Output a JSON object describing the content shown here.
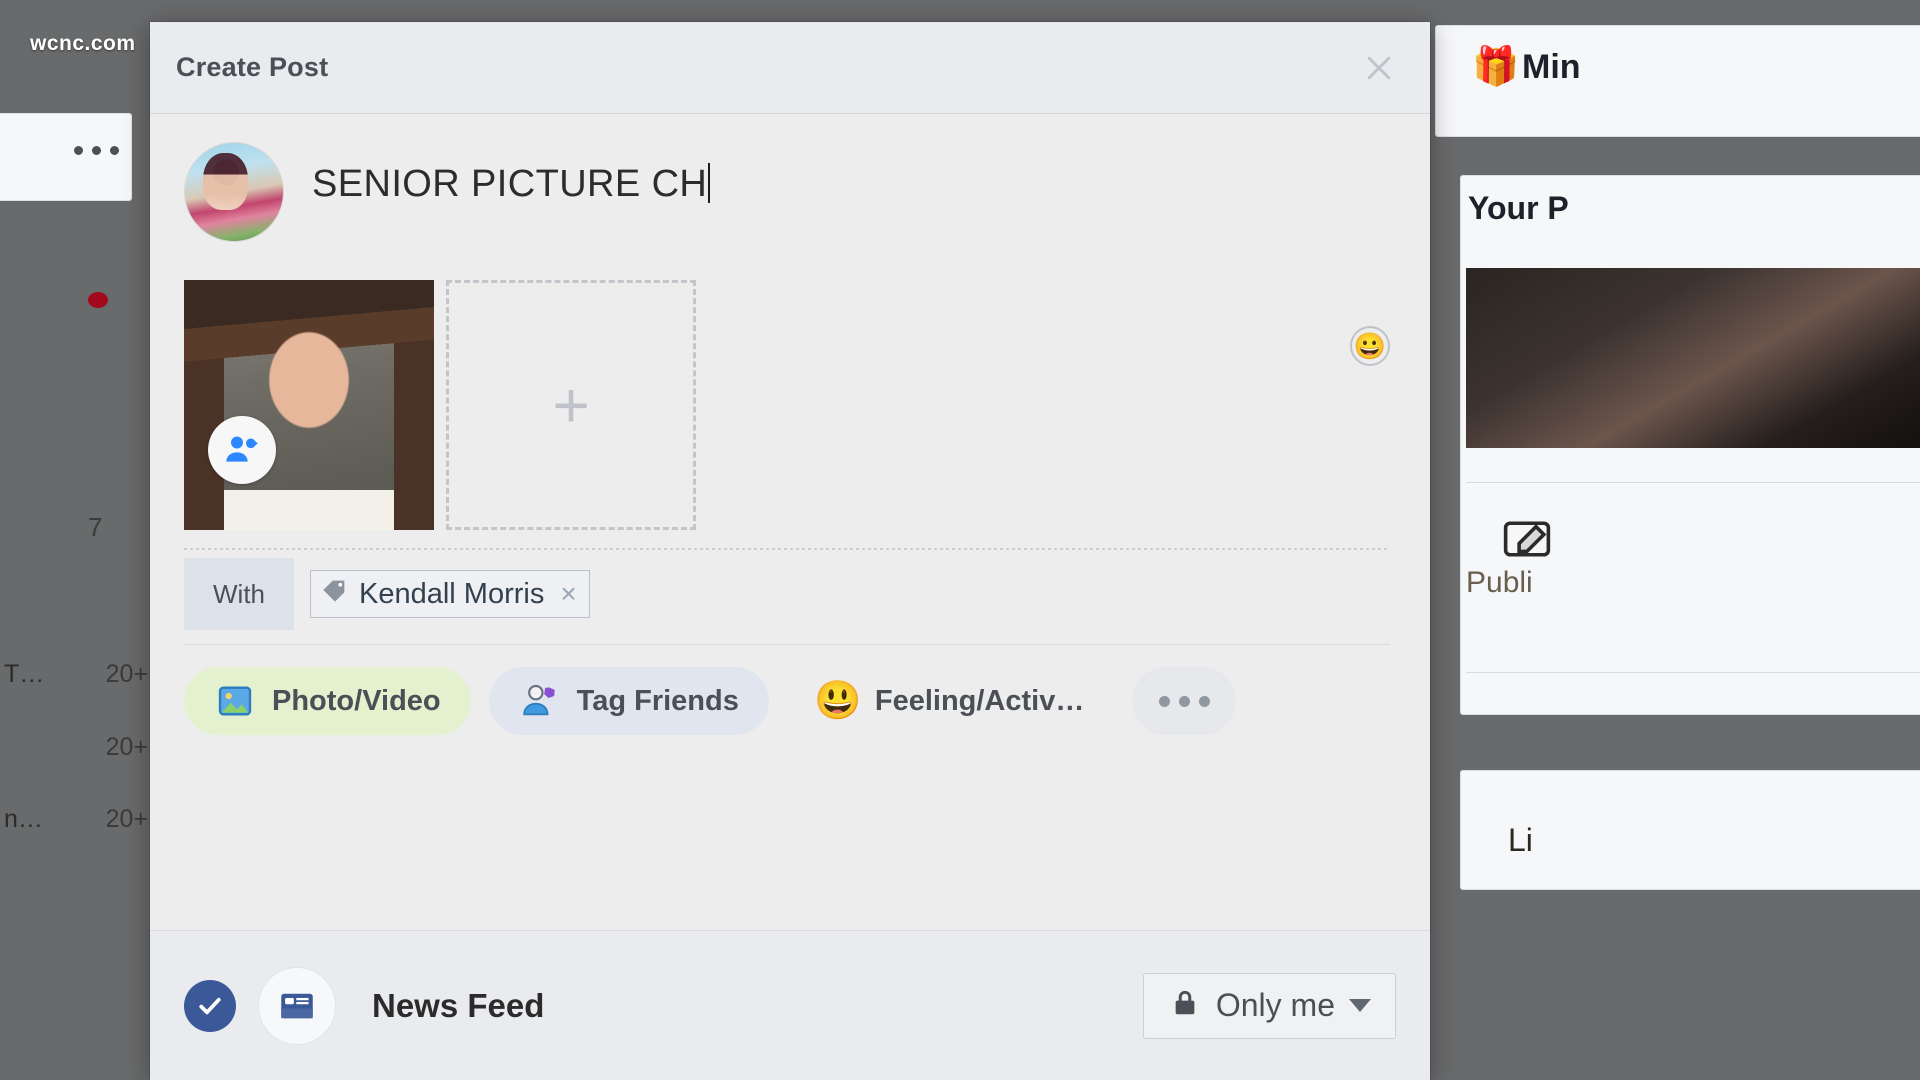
{
  "background": {
    "watermark": "wcnc.com",
    "left_column": {
      "red_dot_label": "",
      "number": "7",
      "rows": [
        {
          "label": "T…",
          "count": "20+"
        },
        {
          "label": "",
          "count": "20+"
        },
        {
          "label": "n…",
          "count": "20+"
        }
      ]
    },
    "right_column": {
      "gift_icon": "gift-icon",
      "mini_label": "Min",
      "your_pages_label": "Your P",
      "publish_label": "Publi",
      "like_label": "Li"
    }
  },
  "modal": {
    "title": "Create Post",
    "close_icon": "close-icon",
    "composer": {
      "avatar": "user-avatar",
      "text": "SENIOR PICTURE CH",
      "emoji_icon": "emoji-smiley-icon"
    },
    "attachments": {
      "photo_tag_icon": "tag-person-icon",
      "add_more_label": "+"
    },
    "tagging": {
      "with_label": "With",
      "tag_icon": "label-tag-icon",
      "person": "Kendall Morris",
      "remove_icon": "×"
    },
    "actions": [
      {
        "name": "photo-video",
        "label": "Photo/Video",
        "icon": "photo-icon",
        "color": "#e3f1cf"
      },
      {
        "name": "tag-friends",
        "label": "Tag Friends",
        "icon": "tag-friends-icon",
        "color": "#e0e5ef"
      },
      {
        "name": "feeling-activity",
        "label": "Feeling/Activ…",
        "icon": "smiley-icon",
        "color": "#ededed"
      },
      {
        "name": "more-options",
        "label": "",
        "icon": "ellipsis-icon",
        "color": "#e6e8eb"
      }
    ],
    "footer": {
      "checked_icon": "check-icon",
      "destination_icon": "news-feed-icon",
      "destination_label": "News Feed",
      "privacy": {
        "icon": "lock-icon",
        "label": "Only me",
        "caret": "chevron-down-icon"
      }
    }
  },
  "colors": {
    "accent": "#3b5998",
    "photo_pill": "#e3f1cf",
    "tag_pill": "#e0e5ef",
    "modal_bg": "#ededee",
    "header_bg": "#e9ebee"
  }
}
